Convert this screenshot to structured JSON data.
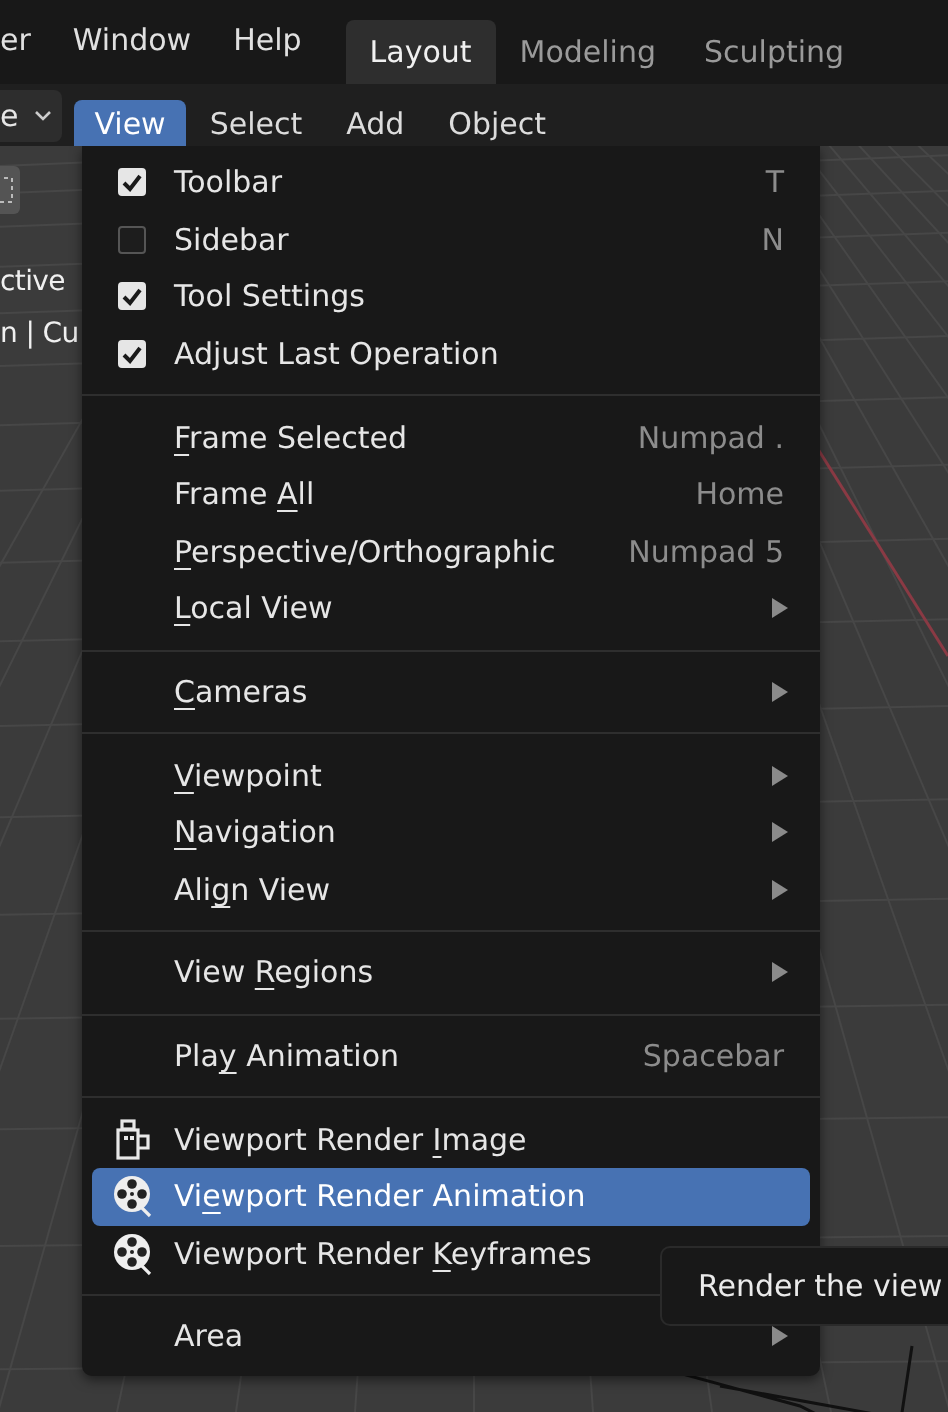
{
  "top_menu": [
    {
      "label": "er"
    },
    {
      "label": "Window"
    },
    {
      "label": "Help"
    }
  ],
  "workspace_tabs": [
    {
      "label": "Layout",
      "selected": true
    },
    {
      "label": "Modeling",
      "selected": false
    },
    {
      "label": "Sculpting",
      "selected": false
    }
  ],
  "header": {
    "mode_dropdown": "e",
    "menus": [
      {
        "label": "View",
        "selected": true
      },
      {
        "label": "Select",
        "selected": false
      },
      {
        "label": "Add",
        "selected": false
      },
      {
        "label": "Object",
        "selected": false
      }
    ]
  },
  "viewport": {
    "side_texts": [
      "ctive",
      "n | Cu"
    ]
  },
  "view_menu": {
    "sections": [
      {
        "items": [
          {
            "kind": "checkbox",
            "checked": true,
            "selected": false,
            "label": {
              "before": "Toolbar"
            },
            "shortcut": "T"
          },
          {
            "kind": "checkbox",
            "checked": false,
            "selected": false,
            "label": {
              "before": "Sidebar"
            },
            "shortcut": "N"
          },
          {
            "kind": "checkbox",
            "checked": true,
            "selected": false,
            "label": {
              "before": "Tool Settings"
            }
          },
          {
            "kind": "checkbox",
            "checked": true,
            "selected": false,
            "label": {
              "before": "Adjust Last Operation"
            }
          }
        ]
      },
      {
        "items": [
          {
            "kind": "action",
            "selected": false,
            "label": {
              "underlined": "F",
              "after": "rame Selected"
            },
            "shortcut": "Numpad ."
          },
          {
            "kind": "action",
            "selected": false,
            "label": {
              "before": "Frame ",
              "underlined": "A",
              "after": "ll"
            },
            "shortcut": "Home"
          },
          {
            "kind": "action",
            "selected": false,
            "label": {
              "underlined": "P",
              "after": "erspective/Orthographic"
            },
            "shortcut": "Numpad 5"
          },
          {
            "kind": "submenu",
            "selected": false,
            "label": {
              "underlined": "L",
              "after": "ocal View"
            }
          }
        ]
      },
      {
        "items": [
          {
            "kind": "submenu",
            "selected": false,
            "label": {
              "underlined": "C",
              "after": "ameras"
            }
          }
        ]
      },
      {
        "items": [
          {
            "kind": "submenu",
            "selected": false,
            "label": {
              "underlined": "V",
              "after": "iewpoint"
            }
          },
          {
            "kind": "submenu",
            "selected": false,
            "label": {
              "underlined": "N",
              "after": "avigation"
            }
          },
          {
            "kind": "submenu",
            "selected": false,
            "label": {
              "before": "Ali",
              "underlined": "g",
              "after": "n View"
            }
          }
        ]
      },
      {
        "items": [
          {
            "kind": "submenu",
            "selected": false,
            "label": {
              "before": "View ",
              "underlined": "R",
              "after": "egions"
            }
          }
        ]
      },
      {
        "items": [
          {
            "kind": "action",
            "selected": false,
            "label": {
              "before": "Pla",
              "underlined": "y",
              "after": " Animation"
            },
            "shortcut": "Spacebar"
          }
        ]
      },
      {
        "items": [
          {
            "kind": "still_render",
            "selected": false,
            "label": {
              "before": "Viewport Render ",
              "underlined": "I",
              "after": "mage"
            }
          },
          {
            "kind": "reel_render",
            "selected": true,
            "label": {
              "before": "Vi",
              "underlined": "e",
              "after": "wport Render Animation"
            }
          },
          {
            "kind": "reel_render",
            "selected": false,
            "label": {
              "before": "Viewport Render ",
              "underlined": "K",
              "after": "eyframes"
            }
          }
        ]
      },
      {
        "items": [
          {
            "kind": "submenu",
            "selected": false,
            "label": {
              "before": "Area"
            }
          }
        ]
      }
    ]
  },
  "tooltip": "Render the view"
}
